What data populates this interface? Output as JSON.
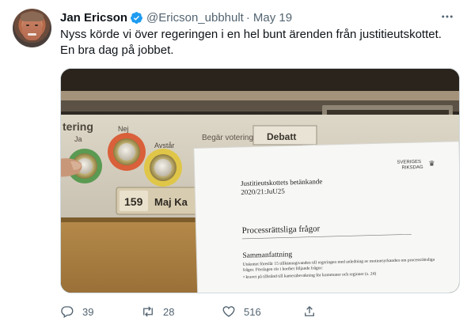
{
  "tweet": {
    "author_name": "Jan Ericson",
    "handle": "@Ericson_ubbhult",
    "separator": "·",
    "date": "May 19",
    "text": "Nyss körde vi över regeringen i en hel bunt ärenden från justitieutskottet. En bra dag på jobbet.",
    "verified_color": "#1d9bf0"
  },
  "media": {
    "panel_label_voting": "tering",
    "button_no": "Nej",
    "button_yes": "Ja",
    "button_abstain": "Avstår",
    "seat_number": "159",
    "seat_name": "Maj Ka",
    "top_label_left": "Begär votering",
    "top_label_right": "Debatt",
    "doc_logo_line1": "SVERIGES",
    "doc_logo_line2": "RIKSDAG",
    "doc_title_line1": "Justitieutskottets betänkande",
    "doc_title_line2": "2020/21:JuU25",
    "doc_heading": "Processrättsliga frågor",
    "doc_subheading": "Sammanfattning",
    "doc_body": "Utskottet föreslår 15 tillkännagivanden till regeringen med anledning av motionsyrkanden om processrättsliga frågor. Förslagen rör i korthet följande frågor:",
    "doc_bullet": "kravet på tillstånd till kamerabevakning för kommuner och regioner (s. 24)"
  },
  "actions": {
    "replies": "39",
    "retweets": "28",
    "likes": "516"
  }
}
